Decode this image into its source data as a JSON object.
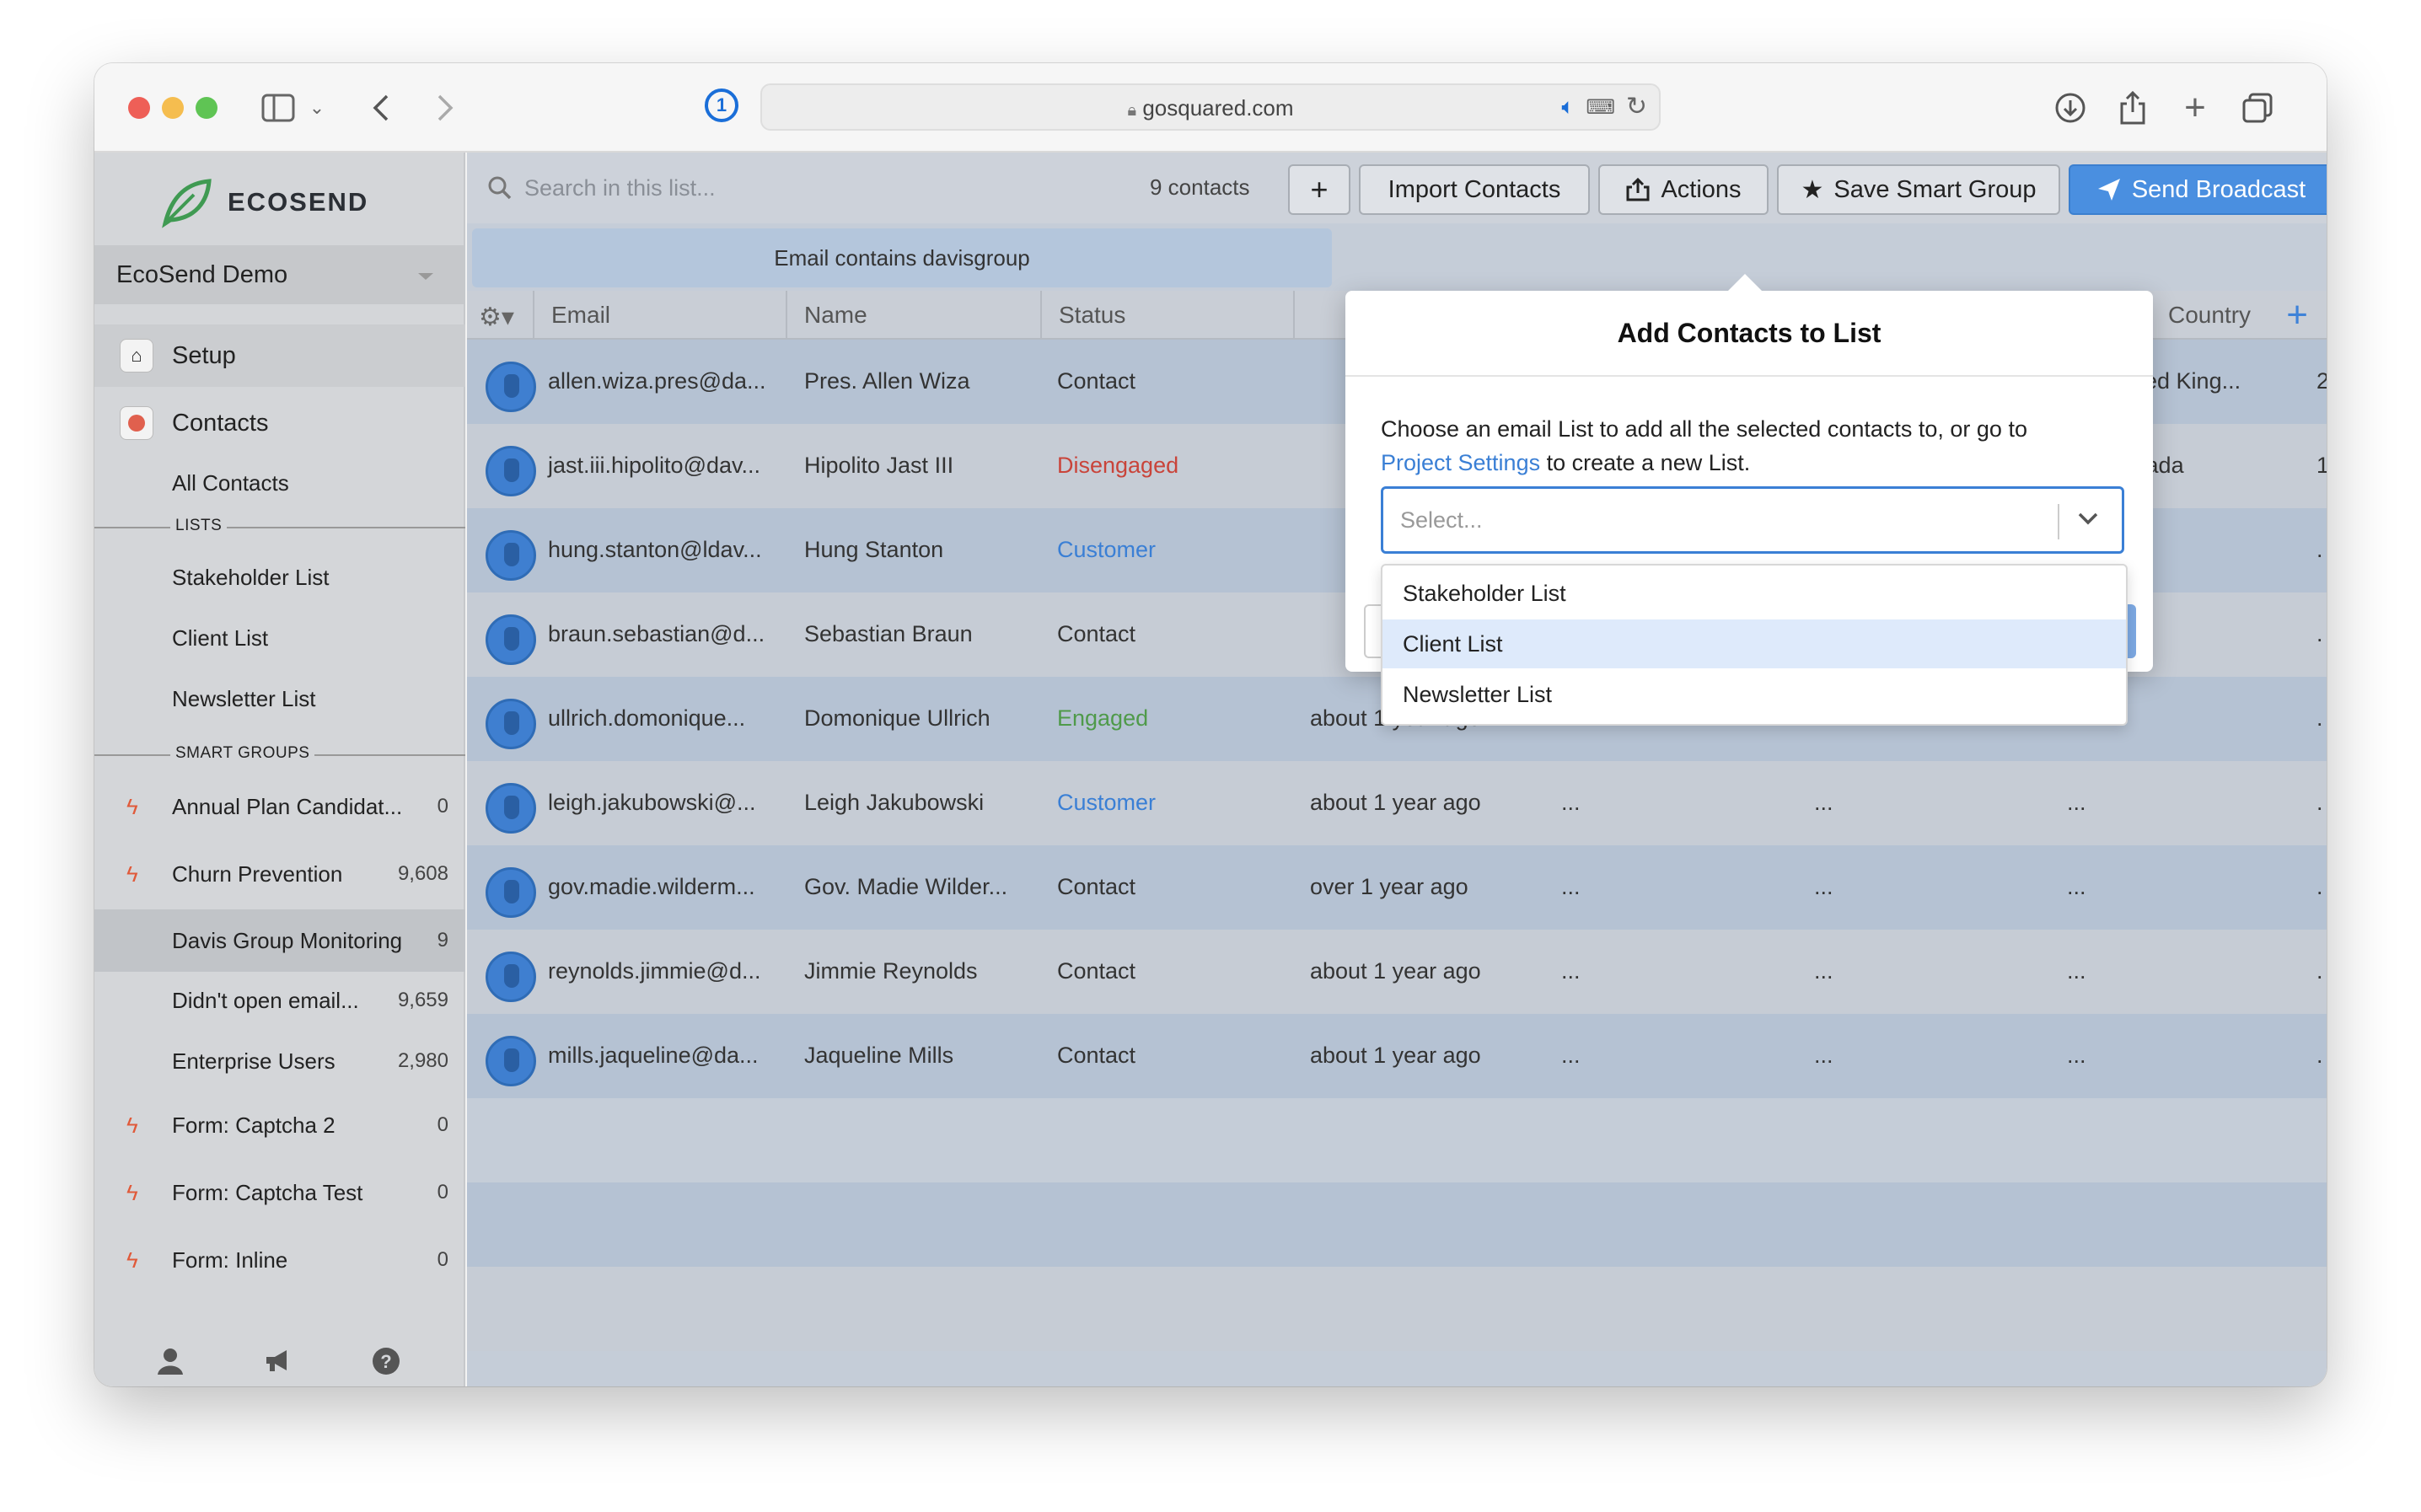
{
  "browser": {
    "url": "gosquared.com"
  },
  "sidebar": {
    "logo_text": "ECOSEND",
    "account": "EcoSend Demo",
    "main_items": [
      {
        "label": "Setup"
      },
      {
        "label": "Contacts"
      }
    ],
    "all_contacts": "All Contacts",
    "lists_heading": "LISTS",
    "lists": [
      {
        "label": "Stakeholder List"
      },
      {
        "label": "Client List"
      },
      {
        "label": "Newsletter List"
      }
    ],
    "smart_groups_heading": "SMART GROUPS",
    "smart_groups": [
      {
        "label": "Annual Plan Candidat...",
        "count": "0",
        "bolt": true
      },
      {
        "label": "Churn Prevention",
        "count": "9,608",
        "bolt": true
      },
      {
        "label": "Davis Group Monitoring",
        "count": "9",
        "bolt": false,
        "active": true
      },
      {
        "label": "Didn't open email...",
        "count": "9,659",
        "bolt": false
      },
      {
        "label": "Enterprise Users",
        "count": "2,980",
        "bolt": false
      },
      {
        "label": "Form: Captcha 2",
        "count": "0",
        "bolt": true
      },
      {
        "label": "Form: Captcha Test",
        "count": "0",
        "bolt": true
      },
      {
        "label": "Form: Inline",
        "count": "0",
        "bolt": true
      }
    ]
  },
  "toolbar": {
    "search_placeholder": "Search in this list...",
    "contacts_count": "9 contacts",
    "add_label": "+",
    "import_label": "Import Contacts",
    "actions_label": "Actions",
    "save_smart_group_label": "Save Smart Group",
    "send_broadcast_label": "Send Broadcast"
  },
  "filter": {
    "text": "Email contains davisgroup"
  },
  "table": {
    "headers": {
      "email": "Email",
      "name": "Name",
      "status": "Status",
      "country": "Country"
    },
    "rows": [
      {
        "email": "allen.wiza.pres@da...",
        "name": "Pres. Allen Wiza",
        "status": "Contact",
        "status_type": "contact",
        "last_seen": "",
        "c1": "",
        "c2": "",
        "country": "United King...",
        "flag": "uk",
        "extra": "2"
      },
      {
        "email": "jast.iii.hipolito@dav...",
        "name": "Hipolito Jast III",
        "status": "Disengaged",
        "status_type": "disengaged",
        "last_seen": "",
        "c1": "",
        "c2": "",
        "country": "Canada",
        "flag": "ca",
        "extra": "1"
      },
      {
        "email": "hung.stanton@ldav...",
        "name": "Hung Stanton",
        "status": "Customer",
        "status_type": "customer",
        "last_seen": "",
        "c1": "",
        "c2": "",
        "country": "...",
        "flag": "",
        "extra": "."
      },
      {
        "email": "braun.sebastian@d...",
        "name": "Sebastian Braun",
        "status": "Contact",
        "status_type": "contact",
        "last_seen": "",
        "c1": "",
        "c2": "",
        "country": "...",
        "flag": "",
        "extra": "."
      },
      {
        "email": "ullrich.domonique...",
        "name": "Domonique Ullrich",
        "status": "Engaged",
        "status_type": "engaged",
        "last_seen": "about 1 year ago",
        "c1": "...",
        "c2": "...",
        "country": "...",
        "flag": "",
        "extra": "."
      },
      {
        "email": "leigh.jakubowski@...",
        "name": "Leigh Jakubowski",
        "status": "Customer",
        "status_type": "customer",
        "last_seen": "about 1 year ago",
        "c1": "...",
        "c2": "...",
        "country": "...",
        "flag": "",
        "extra": "."
      },
      {
        "email": "gov.madie.wilderm...",
        "name": "Gov. Madie Wilder...",
        "status": "Contact",
        "status_type": "contact",
        "last_seen": "over 1 year ago",
        "c1": "...",
        "c2": "...",
        "country": "...",
        "flag": "",
        "extra": "."
      },
      {
        "email": "reynolds.jimmie@d...",
        "name": "Jimmie Reynolds",
        "status": "Contact",
        "status_type": "contact",
        "last_seen": "about 1 year ago",
        "c1": "...",
        "c2": "...",
        "country": "...",
        "flag": "",
        "extra": "."
      },
      {
        "email": "mills.jaqueline@da...",
        "name": "Jaqueline Mills",
        "status": "Contact",
        "status_type": "contact",
        "last_seen": "about 1 year ago",
        "c1": "...",
        "c2": "...",
        "country": "...",
        "flag": "",
        "extra": "."
      }
    ]
  },
  "modal": {
    "title": "Add Contacts to List",
    "desc_before": "Choose an email List to add all the selected contacts to, or go to",
    "desc_link": "Project Settings",
    "desc_after": " to create a new List.",
    "select_placeholder": "Select...",
    "options": [
      {
        "label": "Stakeholder List"
      },
      {
        "label": "Client List",
        "highlighted": true
      },
      {
        "label": "Newsletter List"
      }
    ]
  },
  "colors": {
    "accent": "#3a7fd5",
    "disengaged": "#c9443a",
    "engaged": "#4f9a4a",
    "bolt": "#e05a3a"
  }
}
